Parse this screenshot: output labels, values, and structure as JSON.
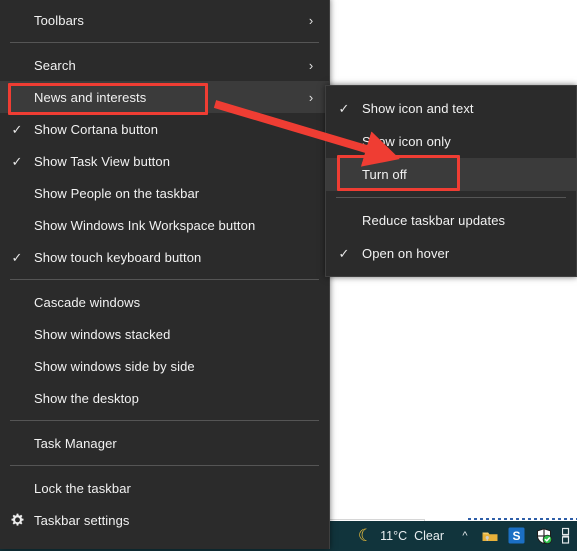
{
  "desktop": {
    "background_color": "#ffffff"
  },
  "taskbar": {
    "background_color": "#11343c",
    "weather": {
      "icon": "moon-icon",
      "icon_glyph": "☽",
      "temperature": "11°C",
      "condition": "Clear"
    },
    "tray": {
      "overflow_chevron": "∧",
      "icons": [
        {
          "name": "hidden-icons-chevron-icon",
          "label": "Show hidden icons"
        },
        {
          "name": "folder-tray-icon",
          "label": "Folder"
        },
        {
          "name": "sogou-input-icon",
          "label": "S"
        },
        {
          "name": "security-shield-icon",
          "label": "Windows Security"
        },
        {
          "name": "ime-status-icon",
          "label": "IME"
        }
      ]
    }
  },
  "context_menu": {
    "name": "taskbar-context-menu",
    "background_color": "#2b2b2b",
    "highlight_color": "#3b3b3b",
    "groups": [
      {
        "items": [
          {
            "label": "Toolbars",
            "checked": false,
            "submenu": true,
            "highlighted": false,
            "icon": null
          }
        ]
      },
      {
        "items": [
          {
            "label": "Search",
            "checked": false,
            "submenu": true,
            "highlighted": false,
            "icon": null
          },
          {
            "label": "News and interests",
            "checked": false,
            "submenu": true,
            "highlighted": true,
            "icon": null
          },
          {
            "label": "Show Cortana button",
            "checked": true,
            "submenu": false,
            "highlighted": false,
            "icon": null
          },
          {
            "label": "Show Task View button",
            "checked": true,
            "submenu": false,
            "highlighted": false,
            "icon": null
          },
          {
            "label": "Show People on the taskbar",
            "checked": false,
            "submenu": false,
            "highlighted": false,
            "icon": null
          },
          {
            "label": "Show Windows Ink Workspace button",
            "checked": false,
            "submenu": false,
            "highlighted": false,
            "icon": null
          },
          {
            "label": "Show touch keyboard button",
            "checked": true,
            "submenu": false,
            "highlighted": false,
            "icon": null
          }
        ]
      },
      {
        "items": [
          {
            "label": "Cascade windows",
            "checked": false,
            "submenu": false,
            "highlighted": false,
            "icon": null
          },
          {
            "label": "Show windows stacked",
            "checked": false,
            "submenu": false,
            "highlighted": false,
            "icon": null
          },
          {
            "label": "Show windows side by side",
            "checked": false,
            "submenu": false,
            "highlighted": false,
            "icon": null
          },
          {
            "label": "Show the desktop",
            "checked": false,
            "submenu": false,
            "highlighted": false,
            "icon": null
          }
        ]
      },
      {
        "items": [
          {
            "label": "Task Manager",
            "checked": false,
            "submenu": false,
            "highlighted": false,
            "icon": null
          }
        ]
      },
      {
        "items": [
          {
            "label": "Lock the taskbar",
            "checked": false,
            "submenu": false,
            "highlighted": false,
            "icon": null
          },
          {
            "label": "Taskbar settings",
            "checked": false,
            "submenu": false,
            "highlighted": false,
            "icon": "gear-icon"
          }
        ]
      }
    ]
  },
  "submenu": {
    "name": "news-and-interests-submenu",
    "groups": [
      {
        "items": [
          {
            "label": "Show icon and text",
            "checked": true,
            "highlighted": false
          },
          {
            "label": "Show icon only",
            "checked": false,
            "highlighted": false
          },
          {
            "label": "Turn off",
            "checked": false,
            "highlighted": true
          }
        ]
      },
      {
        "items": [
          {
            "label": "Reduce taskbar updates",
            "checked": false,
            "highlighted": false
          },
          {
            "label": "Open on hover",
            "checked": true,
            "highlighted": false
          }
        ]
      }
    ]
  },
  "annotations": {
    "color": "#ef3d33",
    "highlight_boxes": [
      {
        "name": "news-and-interests-highlight",
        "target": "News and interests"
      },
      {
        "name": "turn-off-highlight",
        "target": "Turn off"
      }
    ],
    "arrow": {
      "name": "pointer-arrow",
      "from": "News and interests",
      "to": "Turn off"
    }
  },
  "glyphs": {
    "check": "✓",
    "submenu_chevron": "›",
    "gear": "⚙"
  }
}
